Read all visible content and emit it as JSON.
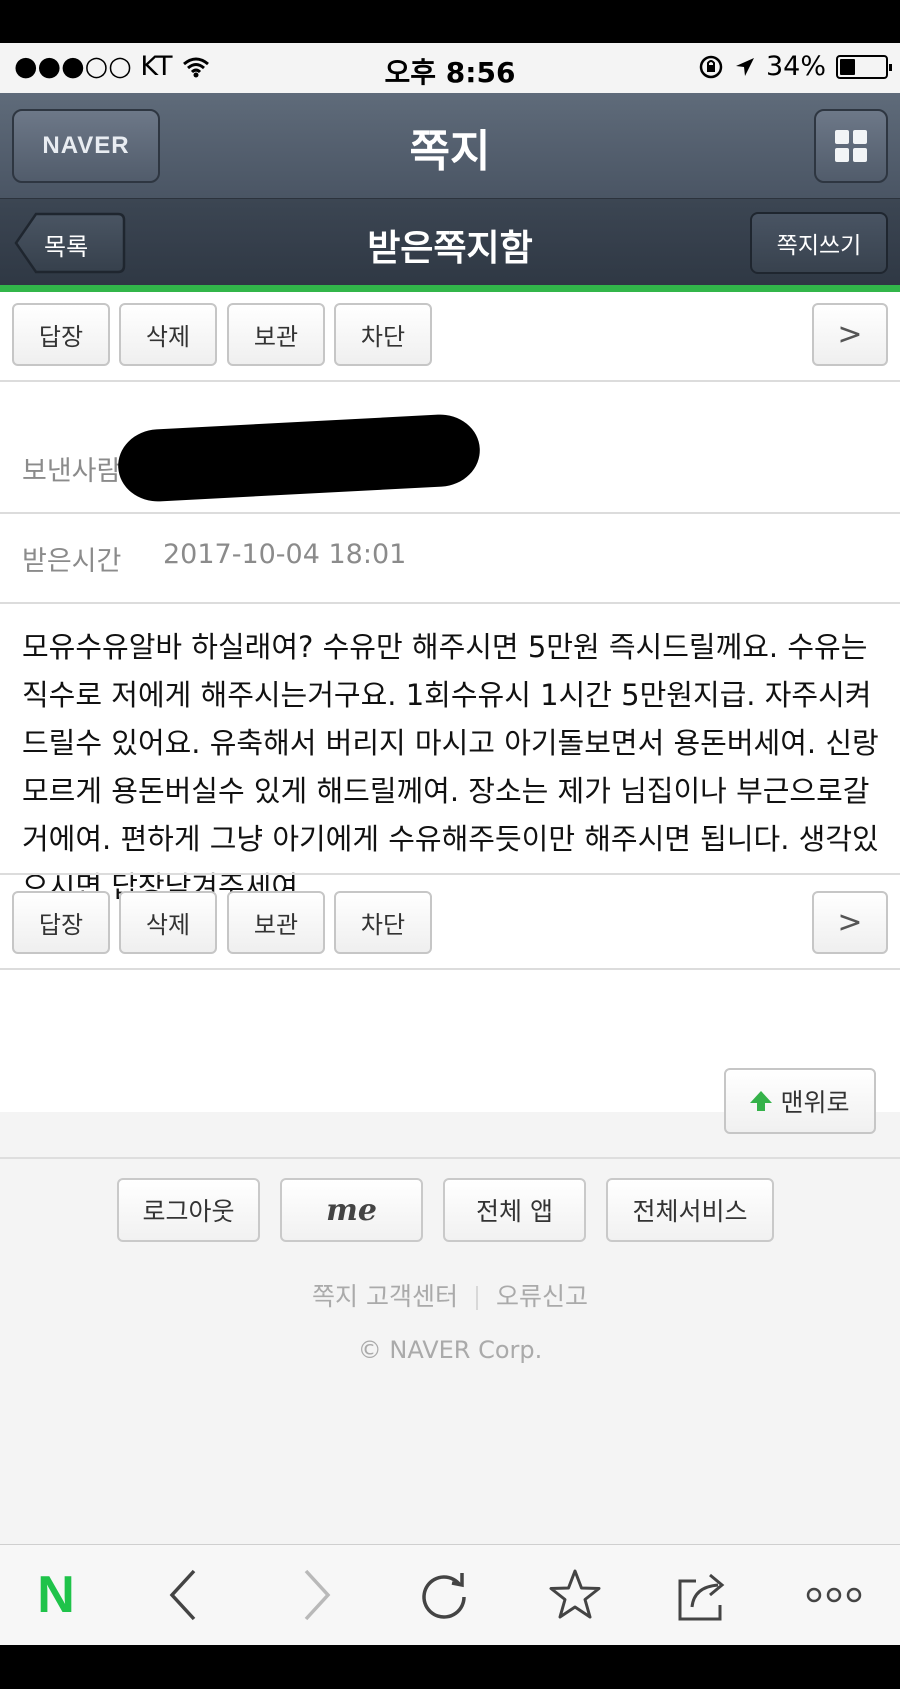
{
  "status_bar": {
    "carrier": "●●●○○ KT",
    "time": "오후 8:56",
    "battery": "34%",
    "battery_level": 0.34
  },
  "header": {
    "brand_button": "NAVER",
    "title": "쪽지"
  },
  "subheader": {
    "back_label": "목록",
    "title": "받은쪽지함",
    "write_label": "쪽지쓰기"
  },
  "toolbar": {
    "reply": "답장",
    "delete": "삭제",
    "archive": "보관",
    "block": "차단",
    "next": ">"
  },
  "message": {
    "sender_label": "보낸사람",
    "received_label": "받은시간",
    "received_time": "2017-10-04 18:01",
    "body": "모유수유알바 하실래여? 수유만 해주시면 5만원 즉시드릴께요. 수유는 직수로 저에게 해주시는거구요. 1회수유시 1시간 5만원지급. 자주시켜드릴수 있어요. 유축해서 버리지 마시고 아기돌보면서 용돈버세여. 신랑모르게 용돈버실수 있게 해드릴께여. 장소는 제가 님집이나 부근으로갈거에여. 편하게 그냥 아기에게 수유해주듯이만 해주시면 됩니다. 생각있으시면 답장남겨주세여."
  },
  "top_button": "맨위로",
  "footer": {
    "logout": "로그아웃",
    "me": "me",
    "all_apps": "전체 앱",
    "all_services": "전체서비스",
    "help_center": "쪽지 고객센터",
    "report": "오류신고",
    "copyright": "© NAVER Corp."
  },
  "browser_bar": {
    "logo": "N",
    "icons": [
      "back-icon",
      "forward-icon",
      "reload-icon",
      "bookmark-star-icon",
      "share-icon",
      "more-icon"
    ]
  },
  "colors": {
    "accent_green": "#32b64a",
    "header_bg": "#55606e"
  }
}
